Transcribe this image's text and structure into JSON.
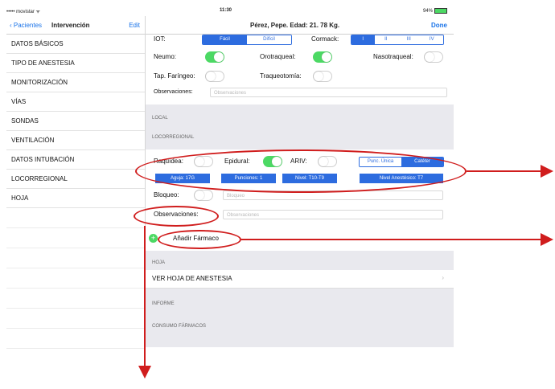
{
  "status_bar": {
    "carrier": "••••• movistar ᯤ",
    "time": "11:30",
    "battery": "94%"
  },
  "sidebar": {
    "back_label": "‹ Pacientes",
    "title": "Intervención",
    "edit_label": "Edit",
    "items": [
      {
        "label": "DATOS BÁSICOS"
      },
      {
        "label": "TIPO DE ANESTESIA"
      },
      {
        "label": "MONITORIZACIÓN"
      },
      {
        "label": "VÍAS"
      },
      {
        "label": "SONDAS"
      },
      {
        "label": "VENTILACIÓN"
      },
      {
        "label": "DATOS INTUBACIÓN"
      },
      {
        "label": "LOCORREGIONAL"
      },
      {
        "label": "HOJA"
      }
    ]
  },
  "detail": {
    "title": "Pérez, Pepe. Edad: 21. 78 Kg.",
    "done_label": "Done",
    "iot": {
      "label": "IOT:",
      "options": [
        "Fácil",
        "Difícil"
      ]
    },
    "cormack": {
      "label": "Cormack:",
      "options": [
        "I",
        "II",
        "III",
        "IV"
      ]
    },
    "neumo": {
      "label": "Neumo:"
    },
    "orotraqueal": {
      "label": "Orotraqueal:"
    },
    "nasotraqueal": {
      "label": "Nasotraqueal:"
    },
    "tap_faringeo": {
      "label": "Tap. Faríngeo:"
    },
    "traqueotomia": {
      "label": "Traqueotomía:"
    },
    "observaciones1": {
      "label": "Observaciones:",
      "placeholder": "Observaciones"
    },
    "section_local": "LOCAL",
    "section_locorregional": "LOCORREGIONAL",
    "raquidea": {
      "label": "Raquídea:"
    },
    "epidural": {
      "label": "Epidural:"
    },
    "ariv": {
      "label": "ARIV:"
    },
    "punc": {
      "options": [
        "Punc. Única",
        "Catéter"
      ]
    },
    "epidural_buttons": [
      "Aguja: 17G",
      "Punciones: 1",
      "Nivel: T10-T9",
      "Nivel Anestésico: T7"
    ],
    "bloqueo": {
      "label": "Bloqueo:",
      "placeholder": "Bloqueo"
    },
    "observaciones2": {
      "label": "Observaciones:",
      "placeholder": "Observaciones"
    },
    "add_drug": {
      "icon": "plus-icon",
      "label": "Añadir Fármaco"
    },
    "section_hoja": "HOJA",
    "ver_hoja": "VER HOJA DE ANESTESIA",
    "section_informe": "INFORME",
    "section_consumo": "CONSUMO FÁRMACOS"
  },
  "colors": {
    "accent": "#2d6cdf",
    "toggle_on": "#4cd964",
    "annotation": "#d01d1d"
  }
}
